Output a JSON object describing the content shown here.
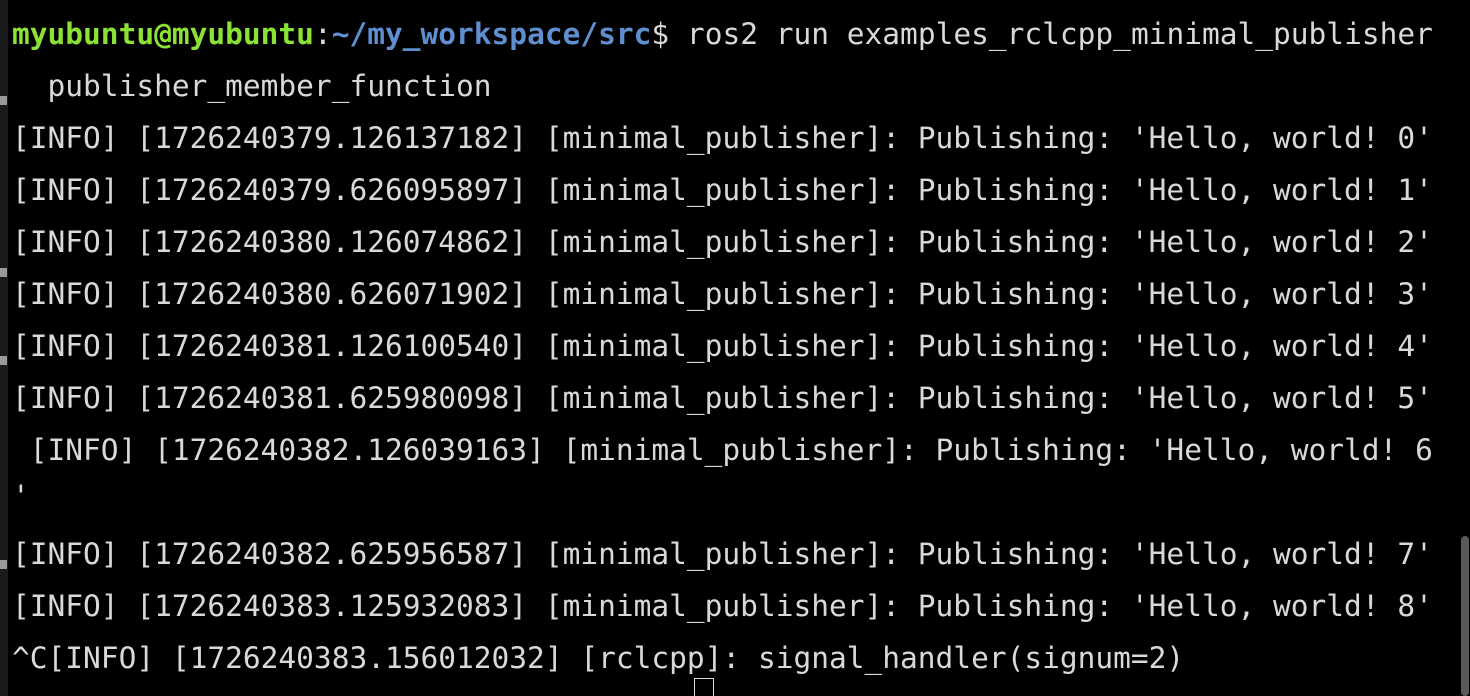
{
  "prompt": {
    "user_host": "myubuntu@myubuntu",
    "colon": ":",
    "path": "~/my_workspace/src",
    "dollar": "$",
    "command": " ros2 run examples_rclcpp_minimal_publisher",
    "command_wrap": "  publisher_member_function"
  },
  "log_lines": [
    "[INFO] [1726240379.126137182] [minimal_publisher]: Publishing: 'Hello, world! 0'",
    "[INFO] [1726240379.626095897] [minimal_publisher]: Publishing: 'Hello, world! 1'",
    "[INFO] [1726240380.126074862] [minimal_publisher]: Publishing: 'Hello, world! 2'",
    "[INFO] [1726240380.626071902] [minimal_publisher]: Publishing: 'Hello, world! 3'",
    "[INFO] [1726240381.126100540] [minimal_publisher]: Publishing: 'Hello, world! 4'",
    "[INFO] [1726240381.625980098] [minimal_publisher]: Publishing: 'Hello, world! 5'",
    " [INFO] [1726240382.126039163] [minimal_publisher]: Publishing: 'Hello, world! 6",
    "'",
    "",
    "[INFO] [1726240382.625956587] [minimal_publisher]: Publishing: 'Hello, world! 7'",
    "[INFO] [1726240383.125932083] [minimal_publisher]: Publishing: 'Hello, world! 8'",
    "^C[INFO] [1726240383.156012032] [rclcpp]: signal_handler(signum=2)"
  ],
  "colors": {
    "background": "#000000",
    "text": "#d9d9d9",
    "prompt_user": "#8ae234",
    "prompt_path": "#5f8fd0"
  }
}
